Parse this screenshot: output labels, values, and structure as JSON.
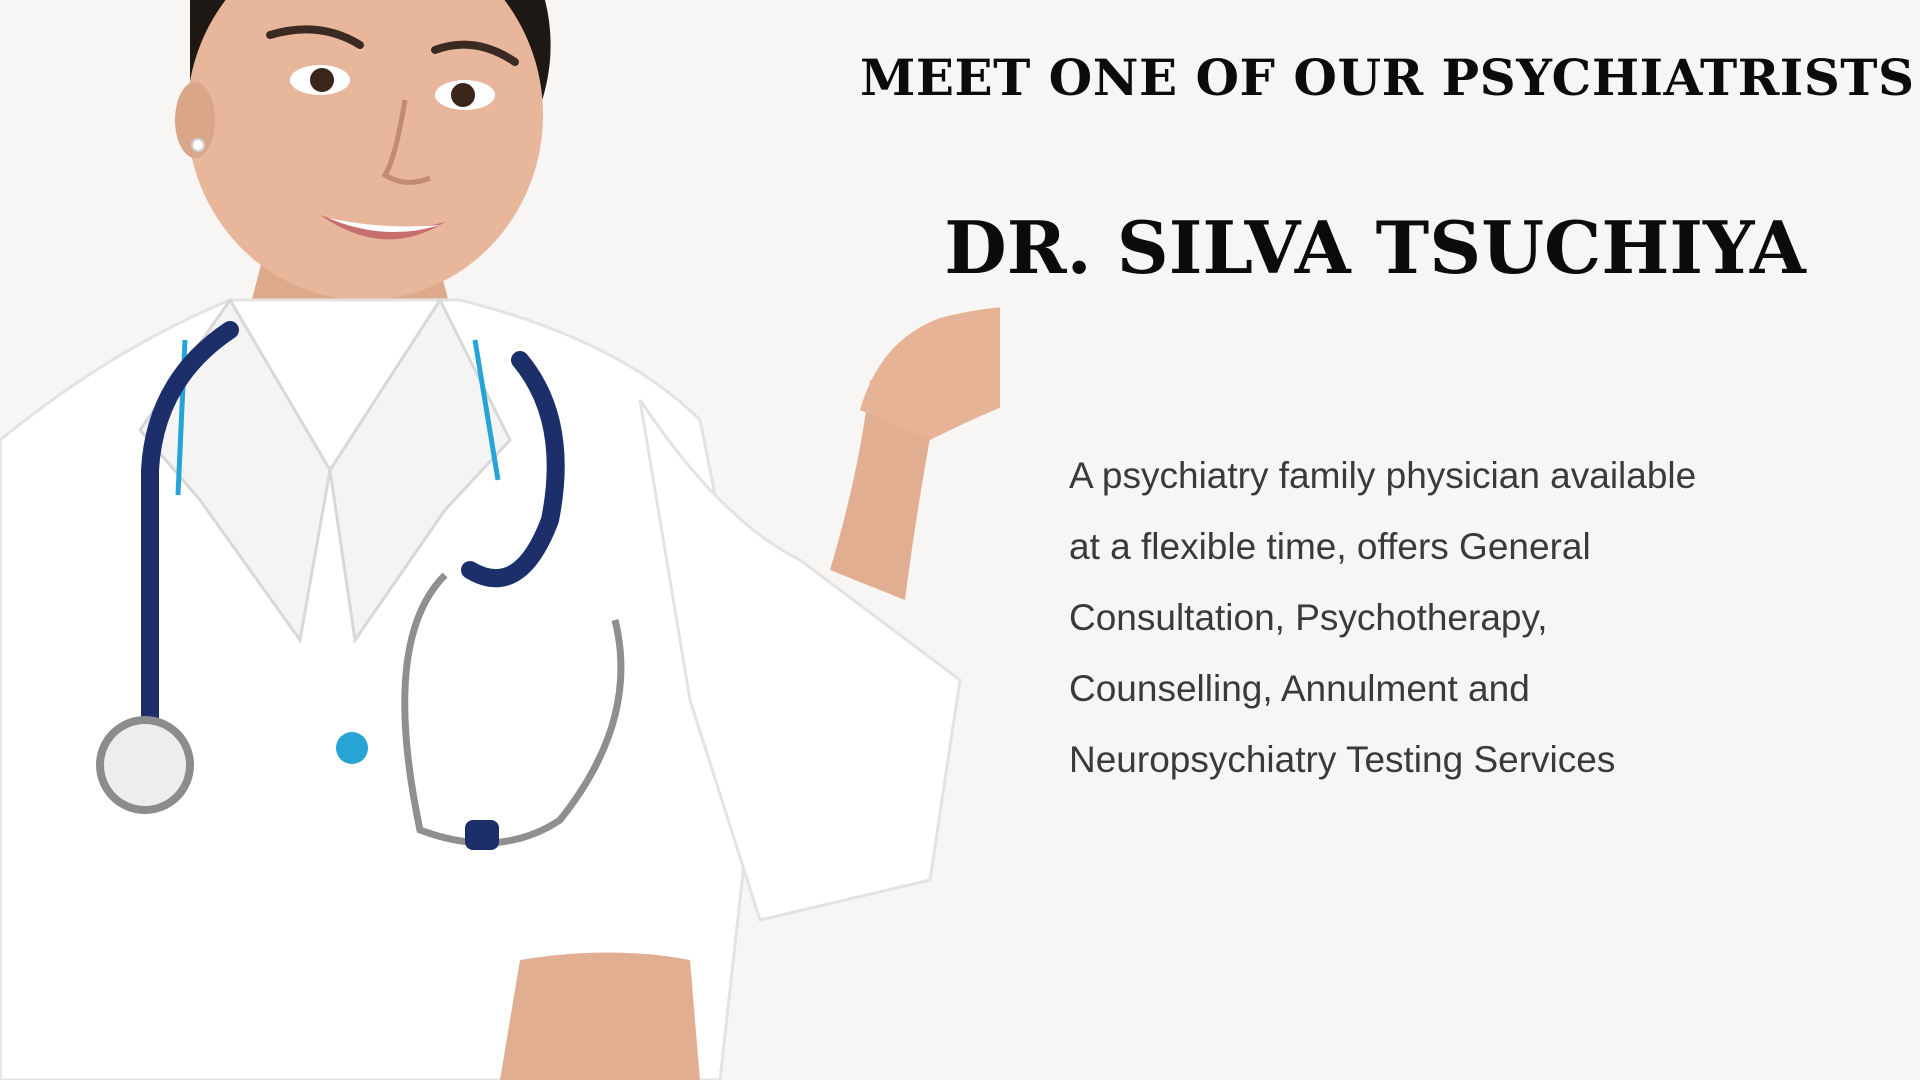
{
  "heading": "MEET ONE OF OUR PSYCHIATRISTS",
  "doctor_name": "DR. SILVA TSUCHIYA",
  "description": "A psychiatry  family physician available\nat a flexible time, offers General\nConsultation, Psychotherapy,\nCounselling, Annulment and\nNeuropsychiatry Testing Services",
  "colors": {
    "background": "#f7f6f4",
    "heading_text": "#0b0b0b",
    "body_text": "#3a3a3a",
    "coat": "#ffffff",
    "stethoscope": "#1c2f6b",
    "collar_accent": "#27a4d6",
    "hair": "#1e1814",
    "skin": "#e8b79b"
  }
}
